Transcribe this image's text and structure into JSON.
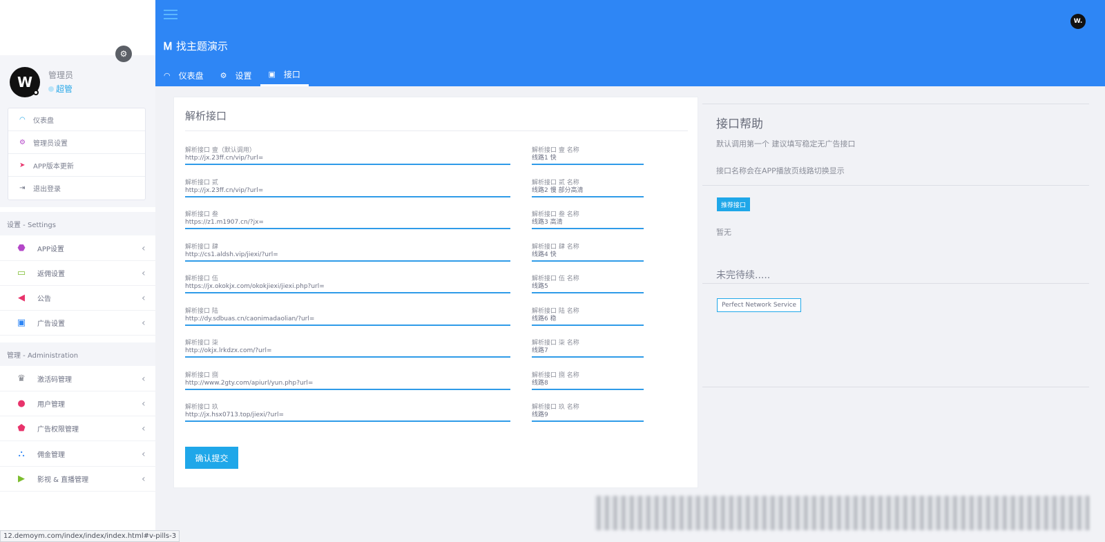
{
  "header": {
    "brand": "找主题演示",
    "tabs": [
      {
        "label": "仪表盘",
        "icon": "dashboard-icon"
      },
      {
        "label": "设置",
        "icon": "gear-icon"
      },
      {
        "label": "接口",
        "icon": "api-icon"
      }
    ],
    "active_tab": "接口"
  },
  "sidebar": {
    "user": {
      "name": "管理员",
      "role": "超管"
    },
    "user_menu": [
      {
        "label": "仪表盘",
        "icon": "dashboard-icon"
      },
      {
        "label": "管理员设置",
        "icon": "cogs-icon"
      },
      {
        "label": "APP版本更新",
        "icon": "send-icon"
      },
      {
        "label": "退出登录",
        "icon": "logout-icon"
      }
    ],
    "sections": [
      {
        "title": "设置 - Settings",
        "items": [
          {
            "label": "APP设置",
            "icon": "android-icon",
            "color": "#b447c8"
          },
          {
            "label": "返佣设置",
            "icon": "credit-card-icon",
            "color": "#7cbd2e"
          },
          {
            "label": "公告",
            "icon": "megaphone-icon",
            "color": "#e8336b"
          },
          {
            "label": "广告设置",
            "icon": "image-icon",
            "color": "#2e86f5"
          }
        ]
      },
      {
        "title": "管理 - Administration",
        "items": [
          {
            "label": "激活码管理",
            "icon": "trophy-icon",
            "color": "#7c7f88"
          },
          {
            "label": "用户管理",
            "icon": "users-icon",
            "color": "#e8336b"
          },
          {
            "label": "广告权限管理",
            "icon": "angular-icon",
            "color": "#e8336b"
          },
          {
            "label": "佣金管理",
            "icon": "sitemap-icon",
            "color": "#2e86f5"
          },
          {
            "label": "影视 & 直播管理",
            "icon": "play-icon",
            "color": "#7cbd2e"
          }
        ]
      }
    ]
  },
  "form": {
    "title": "解析接口",
    "rows": [
      {
        "label": "解析接口 壹（默认调用）",
        "value": "http://jx.23ff.cn/vip/?url=",
        "name_label": "解析接口 壹 名称",
        "name_value": "线路1 快"
      },
      {
        "label": "解析接口 贰",
        "value": "http://jx.23ff.cn/vip/?url=",
        "name_label": "解析接口 贰 名称",
        "name_value": "线路2 慢 部分高清"
      },
      {
        "label": "解析接口 叁",
        "value": "https://z1.m1907.cn/?jx=",
        "name_label": "解析接口 叁 名称",
        "name_value": "线路3 高清"
      },
      {
        "label": "解析接口 肆",
        "value": "http://cs1.aldsh.vip/jiexi/?url=",
        "name_label": "解析接口 肆 名称",
        "name_value": "线路4 快"
      },
      {
        "label": "解析接口 伍",
        "value": "https://jx.okokjx.com/okokjiexi/jiexi.php?url=",
        "name_label": "解析接口 伍 名称",
        "name_value": "线路5"
      },
      {
        "label": "解析接口 陆",
        "value": "http://dy.sdbuas.cn/caonimadaolian/?url=",
        "name_label": "解析接口 陆 名称",
        "name_value": "线路6 稳"
      },
      {
        "label": "解析接口 柒",
        "value": "http://okjx.lrkdzx.com/?url=",
        "name_label": "解析接口 柒 名称",
        "name_value": "线路7"
      },
      {
        "label": "解析接口 捌",
        "value": "http://www.2gty.com/apiurl/yun.php?url=",
        "name_label": "解析接口 捌 名称",
        "name_value": "线路8"
      },
      {
        "label": "解析接口 玖",
        "value": "http://jx.hsx0713.top/jiexi/?url=",
        "name_label": "解析接口 玖 名称",
        "name_value": "线路9"
      }
    ],
    "submit_label": "确认提交"
  },
  "help": {
    "title": "接口帮助",
    "line1": "默认调用第一个 建议填写稳定无广告接口",
    "line2": "接口名称会在APP播放页线路切换显示",
    "recommend_label": "推荐接口",
    "none_text": "暂无",
    "tbc": "未完待续.....",
    "service_label": "Perfect Network Service"
  },
  "status_url": "12.demoym.com/index/index/index.html#v-pills-3",
  "colors": {
    "header_bg": "#2e86f5",
    "accent": "#1fa7e9",
    "input_line": "#2e9be8"
  }
}
